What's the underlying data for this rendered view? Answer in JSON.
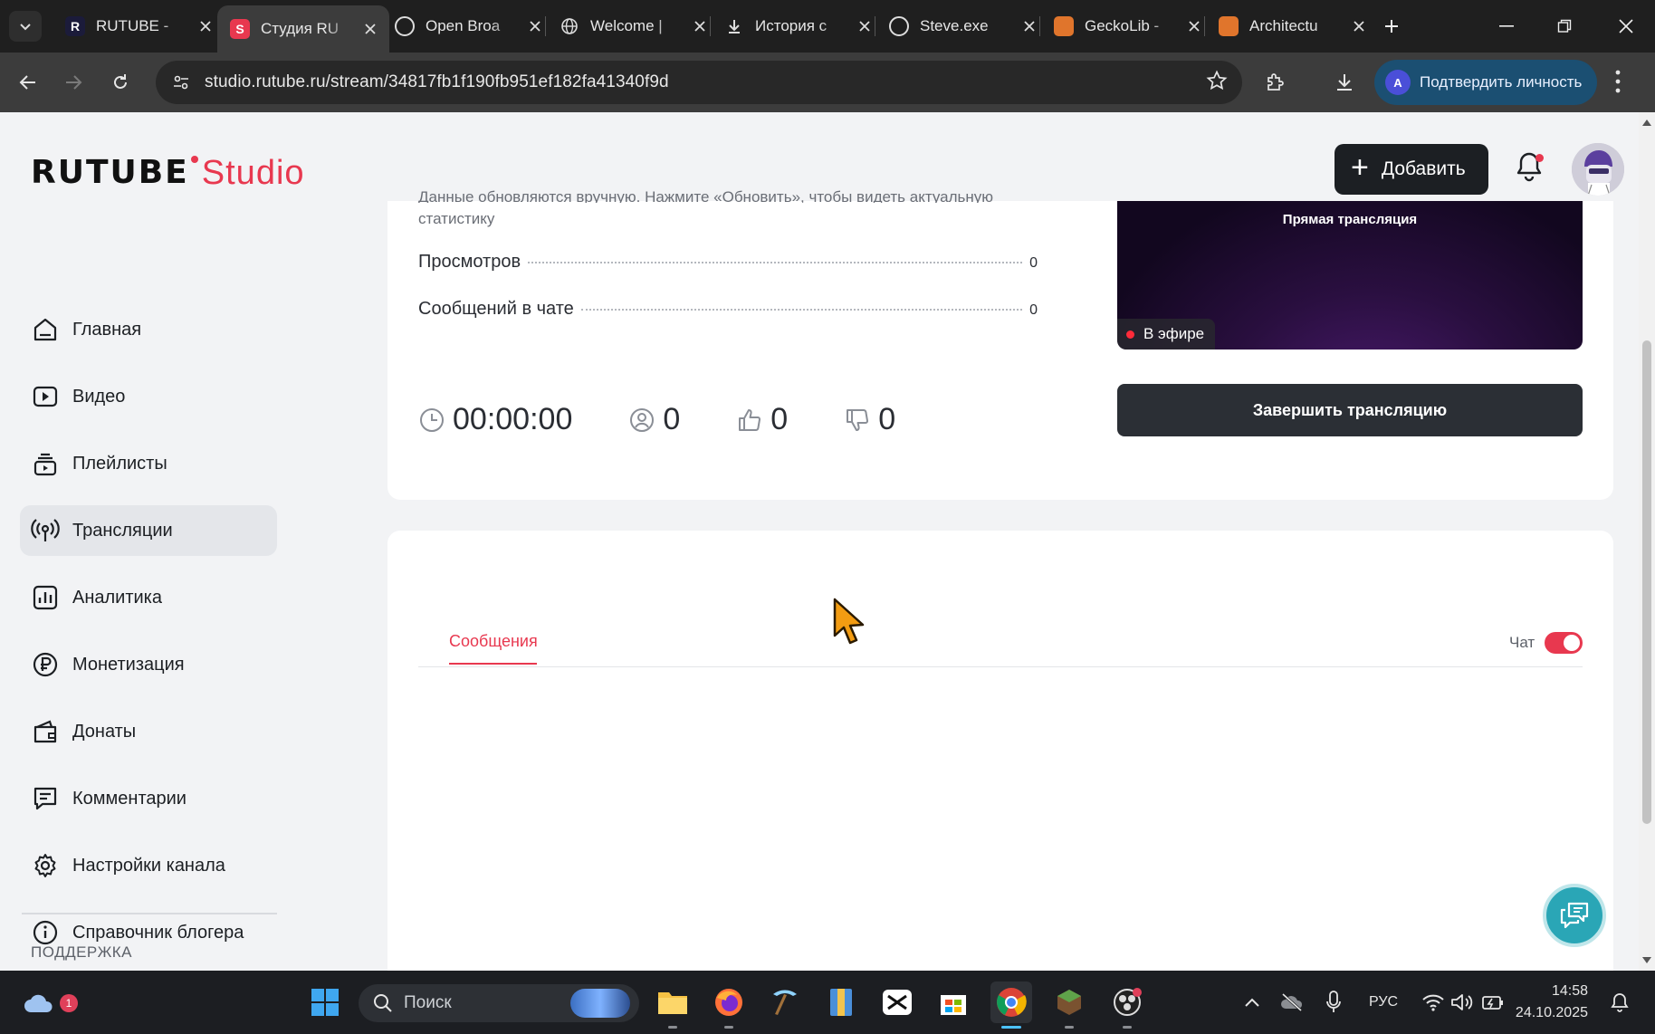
{
  "browser": {
    "tabs": [
      {
        "title": "RUTUBE - ",
        "favicon": "rutube-favicon",
        "active": false
      },
      {
        "title": "Студия RU",
        "favicon": "studio-favicon",
        "active": true
      },
      {
        "title": "Open Broa",
        "favicon": "obs-favicon",
        "active": false
      },
      {
        "title": "Welcome |",
        "favicon": "globe-icon",
        "active": false
      },
      {
        "title": "История с",
        "favicon": "download-icon",
        "active": false
      },
      {
        "title": "Steve.exe",
        "favicon": "steam-icon",
        "active": false
      },
      {
        "title": "GeckoLib -",
        "favicon": "curseforge-icon",
        "active": false
      },
      {
        "title": "Architectu",
        "favicon": "curseforge-icon",
        "active": false
      }
    ],
    "url": "studio.rutube.ru/stream/34817fb1f190fb951ef182fa41340f9d",
    "verify_label": "Подтвердить личность",
    "verify_avatar_letter": "A"
  },
  "header": {
    "logo_brand": "RUTUBE",
    "logo_product": "Studio",
    "add_label": "Добавить"
  },
  "sidebar": {
    "items": [
      {
        "label": "Главная",
        "icon": "home-icon"
      },
      {
        "label": "Видео",
        "icon": "video-icon"
      },
      {
        "label": "Плейлисты",
        "icon": "playlist-icon"
      },
      {
        "label": "Трансляции",
        "icon": "broadcast-icon",
        "active": true
      },
      {
        "label": "Аналитика",
        "icon": "analytics-icon"
      },
      {
        "label": "Монетизация",
        "icon": "ruble-icon"
      },
      {
        "label": "Донаты",
        "icon": "wallet-icon"
      },
      {
        "label": "Комментарии",
        "icon": "comment-icon"
      },
      {
        "label": "Настройки канала",
        "icon": "gear-icon"
      },
      {
        "label": "Справочник блогера",
        "icon": "info-icon"
      }
    ],
    "support_label": "ПОДДЕРЖКА"
  },
  "stream": {
    "clipped_text_top": "Данные обновляются вручную. Нажмите «Обновить», чтобы видеть актуальную",
    "clipped_text_bottom": "статистику",
    "stats": [
      {
        "label": "Просмотров",
        "value": "0"
      },
      {
        "label": "Сообщений в чате",
        "value": "0"
      }
    ],
    "timer": "00:00:00",
    "viewers": "0",
    "likes": "0",
    "dislikes": "0",
    "preview_title": "Прямая трансляция",
    "live_label": "В эфире",
    "end_label": "Завершить трансляцию"
  },
  "chat": {
    "tab_label": "Сообщения",
    "toggle_label": "Чат",
    "toggle_on": true
  },
  "taskbar": {
    "weather_badge": "1",
    "search_placeholder": "Поиск",
    "language": "РУС",
    "time": "14:58",
    "date": "24.10.2025"
  },
  "colors": {
    "accent": "#e8384f",
    "dark_button": "#1c1f23",
    "end_button": "#2b2f35",
    "help_fab": "#2aa6b6"
  }
}
